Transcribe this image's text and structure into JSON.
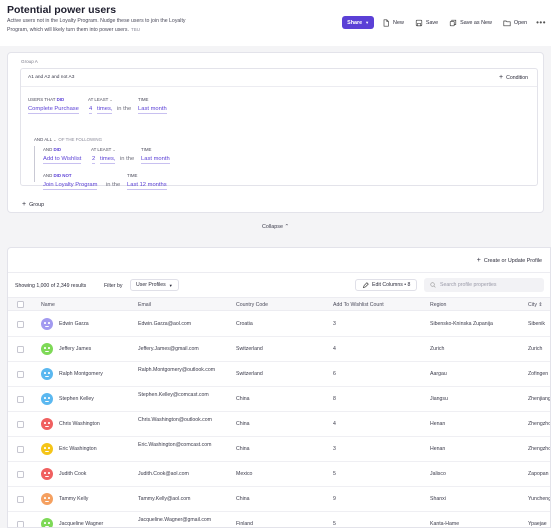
{
  "page": {
    "title": "Potential power users",
    "description": "Active users not in the Loyalty Program. Nudge these users to join the Loyalty Program, which will likely turn them into power users.",
    "last_modified": "TBU"
  },
  "toolbar": {
    "share_label": "Share",
    "new_label": "New",
    "save_label": "Save",
    "save_as_new_label": "Save as New",
    "open_label": "Open",
    "more_label": "•••",
    "accent": "#5b40d6"
  },
  "query": {
    "group_label": "Group A",
    "expression": "A1 and A2 and not A3",
    "add_condition_label": "Condition",
    "condition1": {
      "users_that_label": "USERS THAT",
      "did_label": "DID",
      "event": "Complete Purchase",
      "at_least_label": "AT LEAST",
      "count": "4",
      "times_label": "times,",
      "in_the": "in the",
      "time_label": "TIME",
      "time_value": "Last month"
    },
    "andall_label": "AND ALL",
    "of_following_label": "OF THE FOLLOWING",
    "condition2": {
      "and_label": "AND",
      "did_label": "DID",
      "event": "Add to Wishlist",
      "at_least_label": "AT LEAST",
      "count": "2",
      "times_label": "times,",
      "in_the": "in the",
      "time_label": "TIME",
      "time_value": "Last month"
    },
    "condition3": {
      "and_label": "AND",
      "did_label": "DID NOT",
      "event": "Join Loyalty Program",
      "in_the": "in the",
      "time_label": "TIME",
      "time_value": "Last 12 months"
    },
    "add_group_label": "Group",
    "collapse_label": "Collapse"
  },
  "results": {
    "create_profile_label": "Create or Update Profile",
    "showing_text": "Showing 1,000 of 2,349 results",
    "filter_by_label": "Filter by",
    "filter_value": "User Profiles",
    "edit_columns_label": "Edit Columns • 8",
    "search_placeholder": "Search profile properties",
    "columns": [
      "Name",
      "Email",
      "Country Code",
      "Add To Wishlist Count",
      "Region",
      "City"
    ],
    "rows": [
      {
        "name": "Edwin Garza",
        "email": "Edwin.Garza@aol.com",
        "country": "Croatia",
        "count": "3",
        "region": "Sibensko-Kninska Zupanija",
        "city": "Sibenik",
        "avatar_color": "#a29af0"
      },
      {
        "name": "Jeffery James",
        "email": "Jeffery.James@gmail.com",
        "country": "Switzerland",
        "count": "4",
        "region": "Zurich",
        "city": "Zurich",
        "avatar_color": "#7ed957"
      },
      {
        "name": "Ralph Montgomery",
        "email": "Ralph.Montgomery@outlook.com",
        "country": "Switzerland",
        "count": "6",
        "region": "Aargau",
        "city": "Zofingen",
        "avatar_color": "#5bb8f0"
      },
      {
        "name": "Stephen Kelley",
        "email": "Stephen.Kelley@comcast.com",
        "country": "China",
        "count": "8",
        "region": "Jiangsu",
        "city": "Zhenjiang",
        "avatar_color": "#5bb8f0"
      },
      {
        "name": "Chris Washington",
        "email": "Chris.Washington@outlook.com",
        "country": "China",
        "count": "4",
        "region": "Henan",
        "city": "Zhengzhou",
        "avatar_color": "#f06060"
      },
      {
        "name": "Eric Washington",
        "email": "Eric.Washington@comcast.com",
        "country": "China",
        "count": "3",
        "region": "Henan",
        "city": "Zhengzhou",
        "avatar_color": "#f5c518"
      },
      {
        "name": "Judith Cook",
        "email": "Judith.Cook@aol.com",
        "country": "Mexico",
        "count": "5",
        "region": "Jalisco",
        "city": "Zapopan",
        "avatar_color": "#f06060"
      },
      {
        "name": "Tammy Kelly",
        "email": "Tammy.Kelly@aol.com",
        "country": "China",
        "count": "9",
        "region": "Shanxi",
        "city": "Yuncheng",
        "avatar_color": "#f5a060"
      },
      {
        "name": "Jacqueline Wagner",
        "email": "Jacqueline.Wagner@gmail.com",
        "country": "Finland",
        "count": "5",
        "region": "Kanta-Hame",
        "city": "Ypaejae",
        "avatar_color": "#7ed957"
      }
    ]
  }
}
